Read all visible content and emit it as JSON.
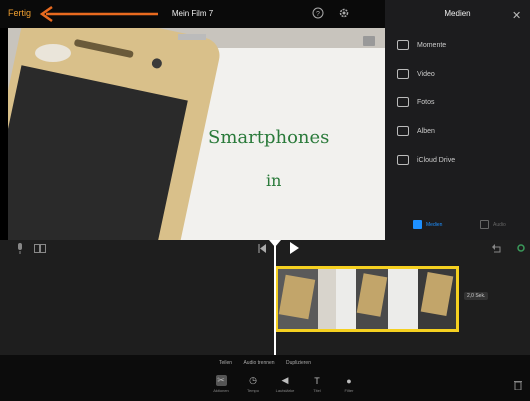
{
  "topbar": {
    "done_label": "Fertig",
    "project_title": "Mein Film 7"
  },
  "media_panel": {
    "title": "Medien",
    "items": [
      {
        "label": "Momente",
        "icon": "moments-icon"
      },
      {
        "label": "Video",
        "icon": "film-icon"
      },
      {
        "label": "Fotos",
        "icon": "photo-icon"
      },
      {
        "label": "Alben",
        "icon": "album-icon"
      },
      {
        "label": "iCloud Drive",
        "icon": "folder-icon"
      }
    ],
    "tabs": {
      "media": "Medien",
      "audio": "Audio"
    }
  },
  "preview": {
    "paper_line1": "Smartphones",
    "paper_line2": "in"
  },
  "timeline": {
    "clip_duration": "2,0 Sek."
  },
  "bottom": {
    "actions": [
      "Teilen",
      "Audio trennen",
      "Duplizieren"
    ],
    "tools": [
      "Aktionen",
      "Tempo",
      "Lautstärke",
      "Titel",
      "Filter"
    ]
  },
  "colors": {
    "accent": "#f0a030",
    "clip_border": "#f5d020",
    "blue": "#1e90ff"
  }
}
